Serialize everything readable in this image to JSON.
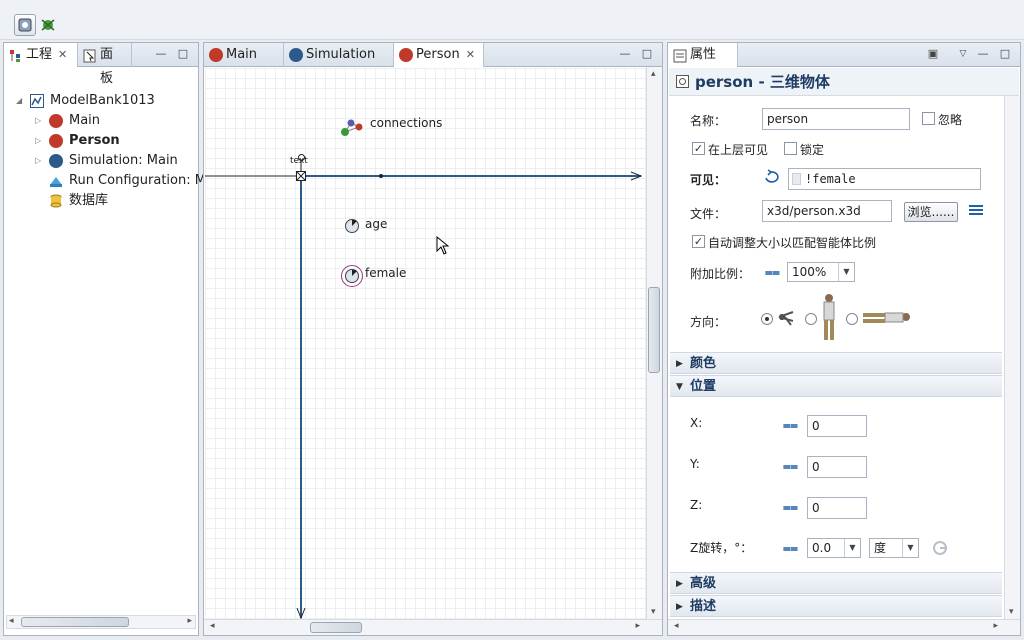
{
  "project_panel": {
    "tabs": [
      {
        "label": "工程"
      },
      {
        "label": "面板"
      }
    ],
    "tree": [
      {
        "label": "ModelBank1013",
        "bold": false
      },
      {
        "label": "Main",
        "bold": false
      },
      {
        "label": "Person",
        "bold": true
      },
      {
        "label": "Simulation: Main",
        "bold": false
      },
      {
        "label": "Run Configuration: M",
        "bold": false
      },
      {
        "label": "数据库",
        "bold": false
      }
    ]
  },
  "editor": {
    "tabs": [
      {
        "label": "Main"
      },
      {
        "label": "Simulation"
      },
      {
        "label": "Person"
      }
    ],
    "canvas_items": {
      "connections": "connections",
      "text": "text",
      "age": "age",
      "female": "female"
    }
  },
  "properties": {
    "tab_label": "属性",
    "title": "person - 三维物体",
    "name_label": "名称：",
    "name_value": "person",
    "ignore_label": "忽略",
    "ignore_checked": false,
    "visible_top_label": "在上层可见",
    "visible_top_checked": true,
    "lock_label": "锁定",
    "lock_checked": false,
    "visible_label": "可见：",
    "visible_value": "!female",
    "file_label": "文件：",
    "file_value": "x3d/person.x3d",
    "browse_label": "浏览......",
    "autosize_label": "自动调整大小以匹配智能体比例",
    "autosize_checked": true,
    "scale_label": "附加比例：",
    "scale_value": "100%",
    "direction_label": "方向：",
    "sections": {
      "color": "颜色",
      "position": "位置",
      "advanced": "高级",
      "description": "描述"
    },
    "x_label": "X:",
    "x_value": "0",
    "y_label": "Y:",
    "y_value": "0",
    "z_label": "Z:",
    "z_value": "0",
    "zrot_label": "Z旋转，°：",
    "zrot_value": "0.0",
    "zrot_unit": "度"
  },
  "colors": {
    "accent": "#1f3c63",
    "axis": "#2c5a8a",
    "agent_red": "#c0392b",
    "sim_blue": "#2c5a8a"
  }
}
